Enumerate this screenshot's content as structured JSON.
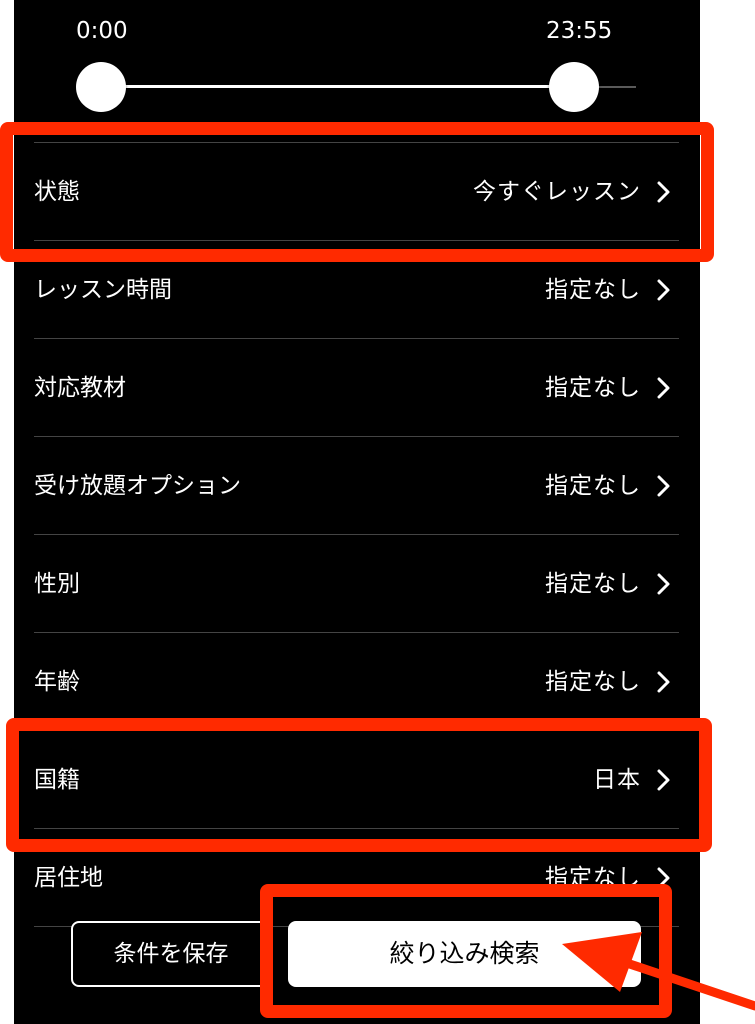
{
  "slider": {
    "start_label": "0:00",
    "end_label": "23:55",
    "start_value": 0.0,
    "end_value": 0.88
  },
  "filters": [
    {
      "label": "状態",
      "value": "今すぐレッスン"
    },
    {
      "label": "レッスン時間",
      "value": "指定なし"
    },
    {
      "label": "対応教材",
      "value": "指定なし"
    },
    {
      "label": "受け放題オプション",
      "value": "指定なし"
    },
    {
      "label": "性別",
      "value": "指定なし"
    },
    {
      "label": "年齢",
      "value": "指定なし"
    },
    {
      "label": "国籍",
      "value": "日本"
    },
    {
      "label": "居住地",
      "value": "指定なし"
    }
  ],
  "actions": {
    "save_label": "条件を保存",
    "search_label": "絞り込み検索"
  },
  "colors": {
    "background": "#000000",
    "text": "#ffffff",
    "highlight": "#ff2a00",
    "divider": "#444444"
  }
}
